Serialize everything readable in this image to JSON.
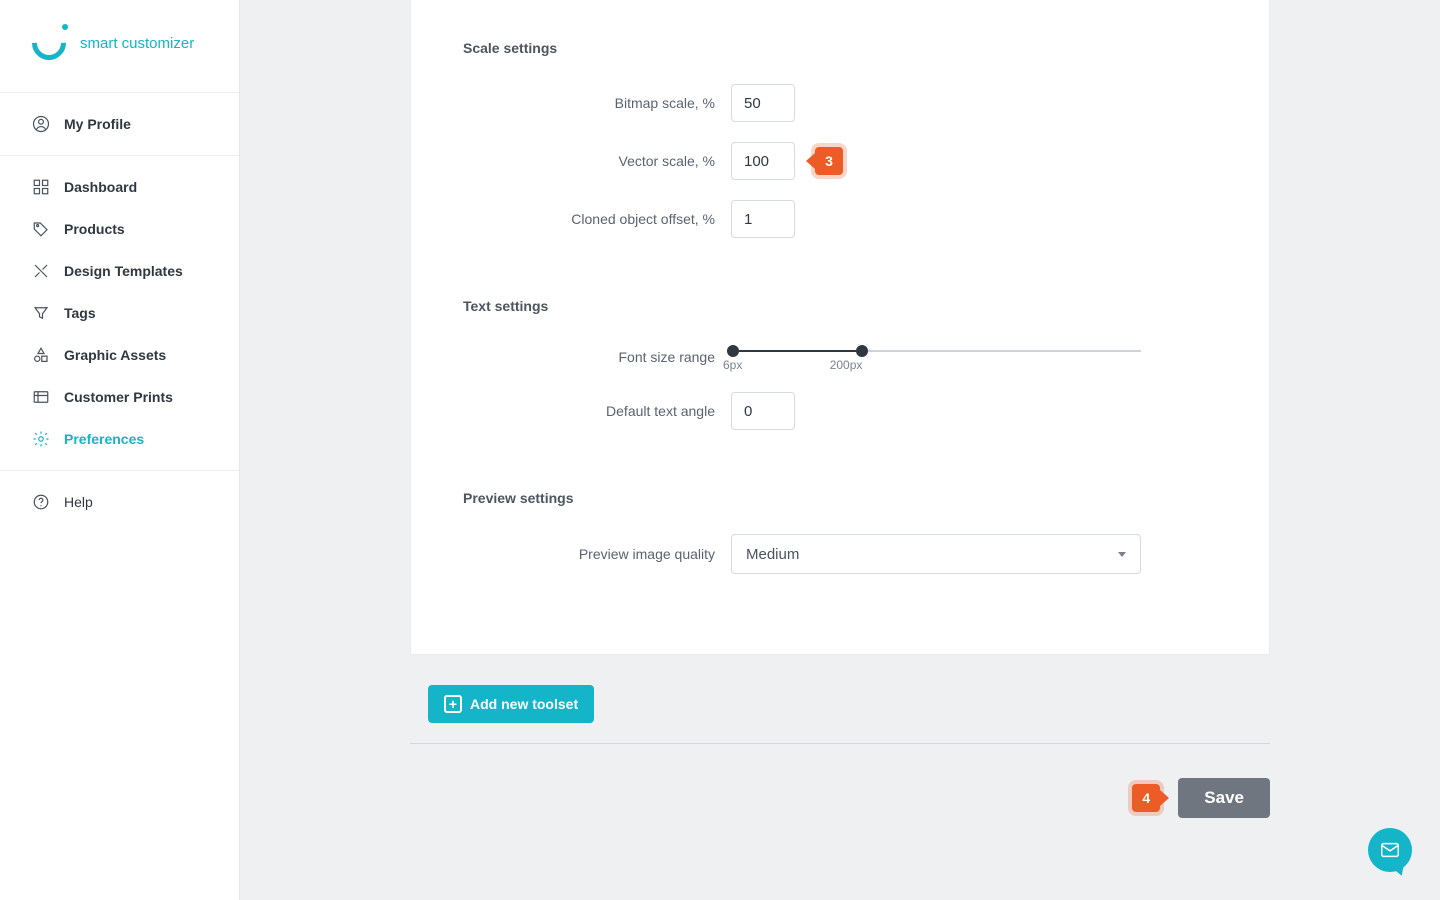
{
  "brand": {
    "name": "smart customizer"
  },
  "sidebar": {
    "profile_label": "My Profile",
    "items": [
      {
        "label": "Dashboard"
      },
      {
        "label": "Products"
      },
      {
        "label": "Design Templates"
      },
      {
        "label": "Tags"
      },
      {
        "label": "Graphic Assets"
      },
      {
        "label": "Customer Prints"
      },
      {
        "label": "Preferences"
      }
    ],
    "help_label": "Help"
  },
  "sections": {
    "scale": {
      "title": "Scale settings",
      "bitmap_label": "Bitmap scale, %",
      "bitmap_value": "50",
      "vector_label": "Vector scale, %",
      "vector_value": "100",
      "clone_label": "Cloned object offset, %",
      "clone_value": "1"
    },
    "text": {
      "title": "Text settings",
      "range_label": "Font size range",
      "range_min": "6px",
      "range_max": "200px",
      "angle_label": "Default text angle",
      "angle_value": "0"
    },
    "preview": {
      "title": "Preview settings",
      "quality_label": "Preview image quality",
      "quality_value": "Medium"
    }
  },
  "buttons": {
    "add_toolset": "Add new toolset",
    "save": "Save"
  },
  "callouts": {
    "c3": "3",
    "c4": "4"
  }
}
